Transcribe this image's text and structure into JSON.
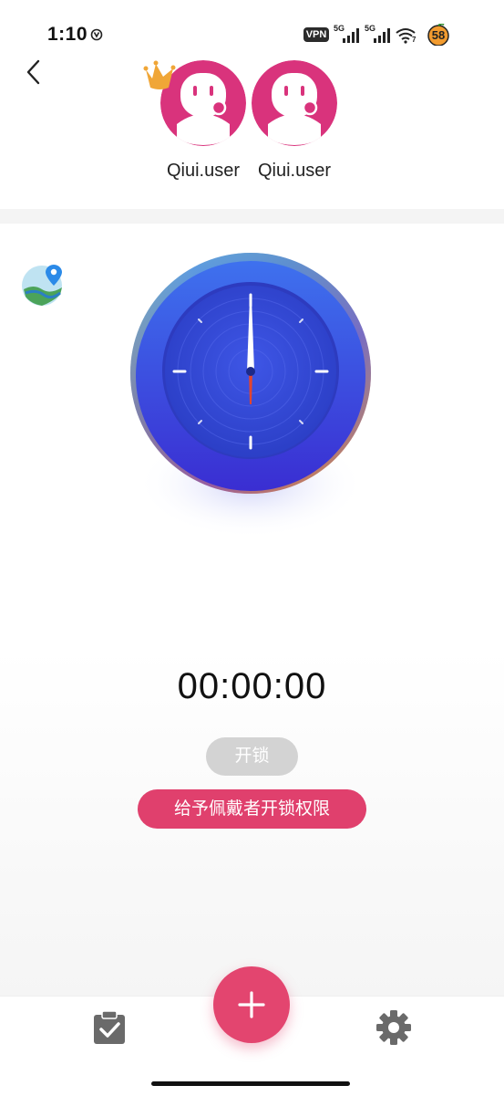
{
  "status_bar": {
    "time": "1:10",
    "vpn": "VPN",
    "network_1": "5G",
    "network_2": "5G",
    "wifi_level": "7",
    "battery": "58"
  },
  "header": {
    "users": [
      {
        "name": "Qiui.user",
        "crowned": true
      },
      {
        "name": "Qiui.user",
        "crowned": false
      }
    ],
    "avatar_color": "#d9337c",
    "crown_color": "#f0a637"
  },
  "main": {
    "timer": "00:00:00",
    "unlock_label": "开锁",
    "grant_label": "给予佩戴者开锁权限",
    "accent_color": "#e0406d",
    "disabled_color": "#d3d3d3"
  },
  "icons": {
    "back": "back-chevron-icon",
    "map": "map-location-icon",
    "add": "plus-icon",
    "tasks": "clipboard-check-icon",
    "settings": "gear-icon"
  }
}
